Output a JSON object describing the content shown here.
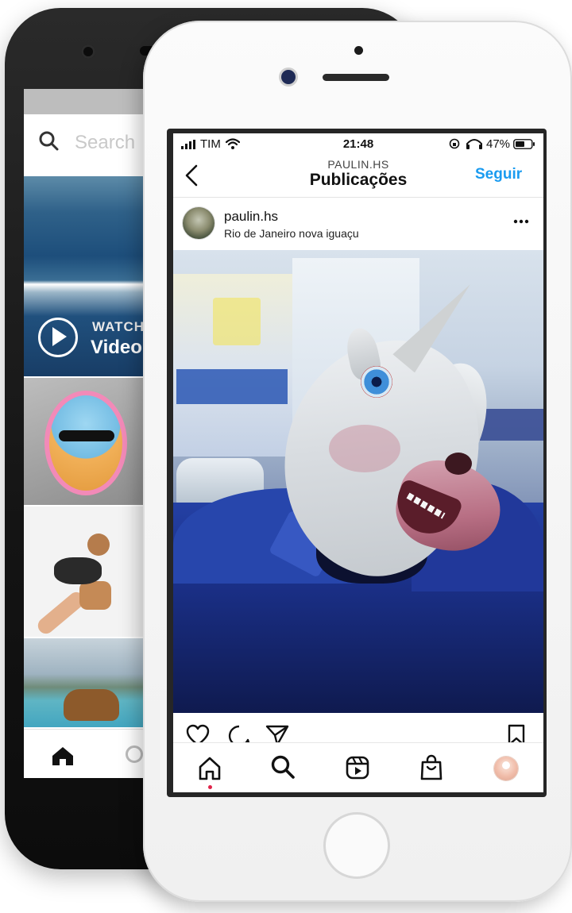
{
  "back_phone": {
    "search_placeholder": "Search",
    "tiles": [
      {
        "watch_label": "WATCH",
        "video_label": "Video"
      }
    ]
  },
  "status_bar": {
    "carrier": "TIM",
    "time": "21:48",
    "battery": "47%"
  },
  "header": {
    "username": "PAULIN.HS",
    "title": "Publicações",
    "follow_label": "Seguir"
  },
  "post": {
    "username": "paulin.hs",
    "location": "Rio de Janeiro nova iguaçu"
  },
  "icons": {
    "back": "chevron-left-icon",
    "more": "more-horizontal-icon",
    "like": "heart-icon",
    "comment": "comment-icon",
    "share": "paper-plane-icon",
    "save": "bookmark-icon",
    "nav": [
      "home-icon",
      "search-icon",
      "reels-icon",
      "shop-icon",
      "profile-avatar"
    ]
  },
  "colors": {
    "follow_blue": "#1a9bf0",
    "nav_active_dot": "#e0244a"
  }
}
